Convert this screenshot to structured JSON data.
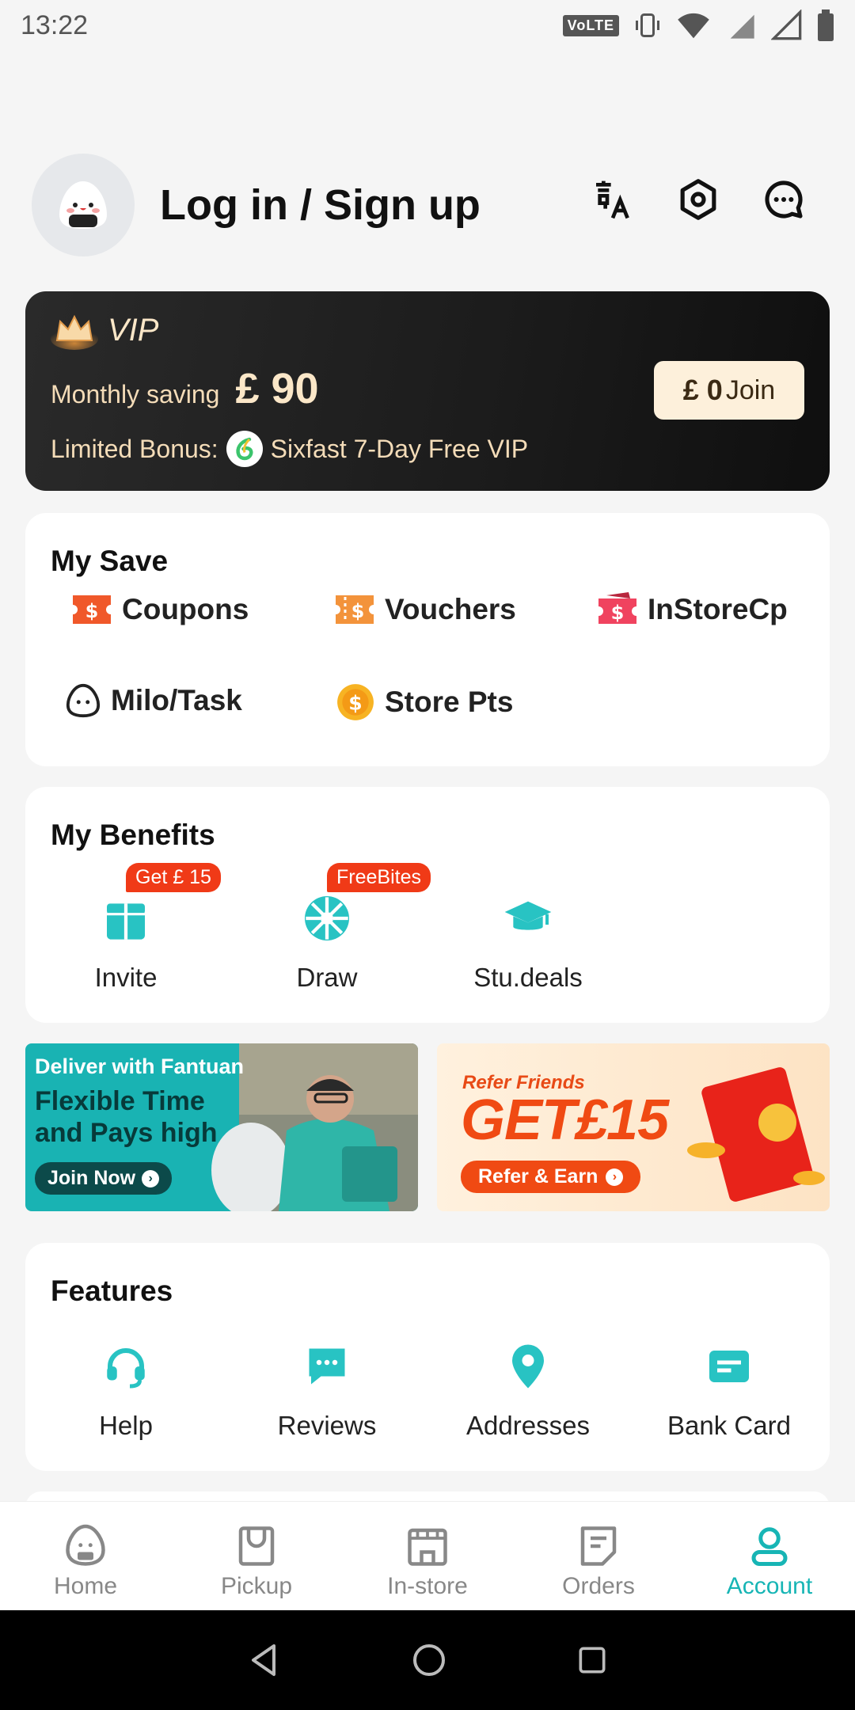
{
  "status_bar": {
    "time": "13:22",
    "volte": "VoLTE"
  },
  "header": {
    "login_label": "Log in / Sign up"
  },
  "vip": {
    "title": "VIP",
    "saving_label": "Monthly saving",
    "saving_amount": "£ 90",
    "bonus_label": "Limited Bonus:",
    "bonus_text": "Sixfast 7-Day Free VIP",
    "join_amount": "£ 0",
    "join_label": "Join"
  },
  "my_save": {
    "title": "My Save",
    "items": [
      {
        "label": "Coupons",
        "icon": "coupon-icon"
      },
      {
        "label": "Vouchers",
        "icon": "voucher-icon"
      },
      {
        "label": "InStoreCp",
        "icon": "instore-coupon-icon"
      },
      {
        "label": "Milo/Task",
        "icon": "milo-icon"
      },
      {
        "label": "Store Pts",
        "icon": "coin-icon"
      }
    ]
  },
  "my_benefits": {
    "title": "My Benefits",
    "items": [
      {
        "label": "Invite",
        "badge": "Get  £ 15",
        "icon": "gift-icon"
      },
      {
        "label": "Draw",
        "badge": "FreeBites",
        "icon": "wheel-icon"
      },
      {
        "label": "Stu.deals",
        "badge": "",
        "icon": "graduation-cap-icon"
      }
    ]
  },
  "banners": {
    "deliver": {
      "line1": "Deliver with Fantuan",
      "line2": "Flexible Time",
      "line3": "and Pays high",
      "cta": "Join Now"
    },
    "refer": {
      "line1": "Refer Friends",
      "line2": "GET£15",
      "cta": "Refer & Earn"
    }
  },
  "features": {
    "title": "Features",
    "items": [
      {
        "label": "Help",
        "icon": "headset-icon"
      },
      {
        "label": "Reviews",
        "icon": "chat-bubble-icon"
      },
      {
        "label": "Addresses",
        "icon": "location-pin-icon"
      },
      {
        "label": "Bank Card",
        "icon": "bank-card-icon"
      }
    ]
  },
  "bottom_nav": {
    "items": [
      {
        "label": "Home",
        "icon": "home-icon"
      },
      {
        "label": "Pickup",
        "icon": "bag-icon"
      },
      {
        "label": "In-store",
        "icon": "store-icon"
      },
      {
        "label": "Orders",
        "icon": "orders-icon"
      },
      {
        "label": "Account",
        "icon": "account-icon",
        "active": true
      }
    ]
  },
  "colors": {
    "accent": "#17b5b5",
    "badge": "#f03a17",
    "vip_bg": "#1b1b1b"
  }
}
